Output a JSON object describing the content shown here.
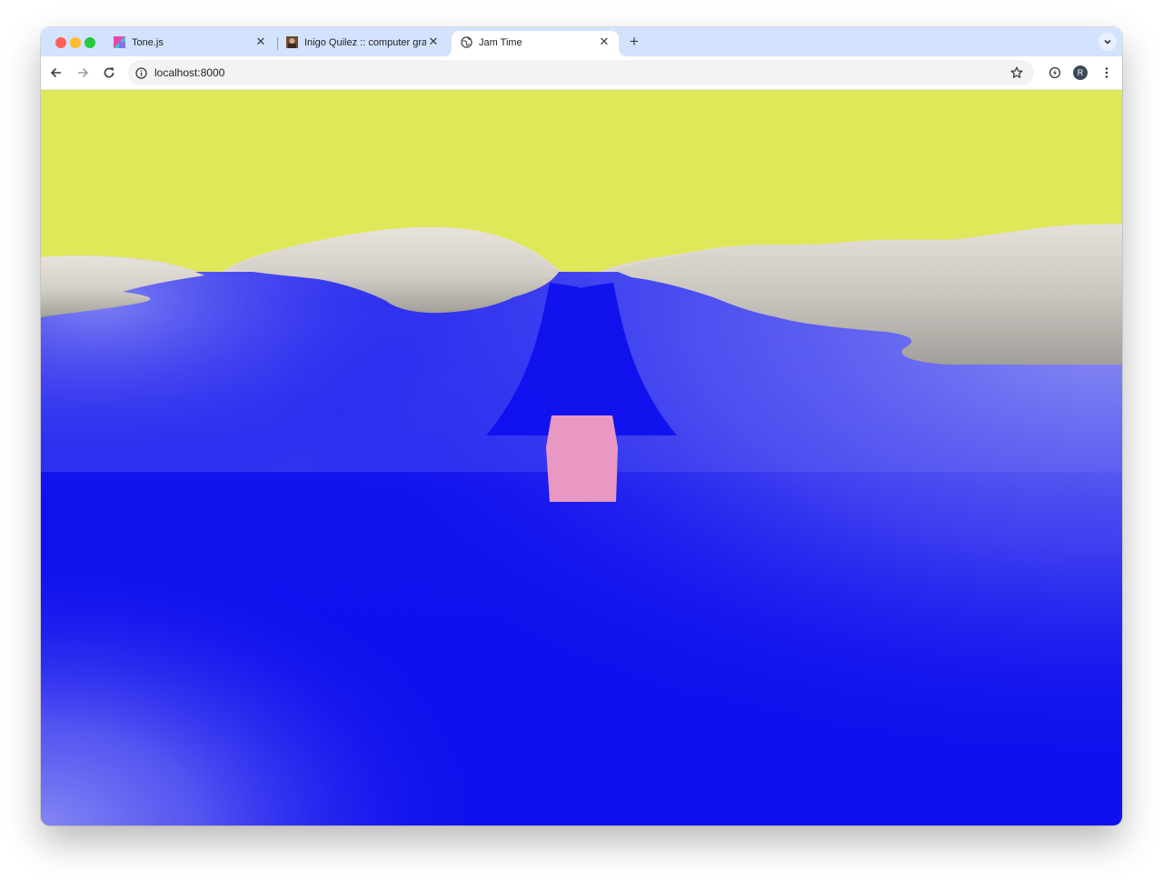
{
  "browser": {
    "tabs": [
      {
        "title": "Tone.js",
        "favicon": "tonejs-favicon",
        "active": false
      },
      {
        "title": "Inigo Quilez :: computer graphics, mathematics, shaders, fractals, demoscene and more",
        "favicon": "iq-avatar-favicon",
        "active": false
      },
      {
        "title": "Jam Time",
        "favicon": "globe-icon",
        "active": true
      }
    ],
    "new_tab_label": "+",
    "close_glyph": "✕",
    "address": {
      "url": "localhost:8000"
    },
    "profile_initial": "R"
  },
  "scene": {
    "sky_color": "#dee858",
    "water_color": "#1010ee",
    "water_light_color": "#8a8cf2",
    "terrain_light_color": "#e3ddd6",
    "terrain_dark_color": "#a7a39d",
    "cube_color": "#e998c3"
  }
}
